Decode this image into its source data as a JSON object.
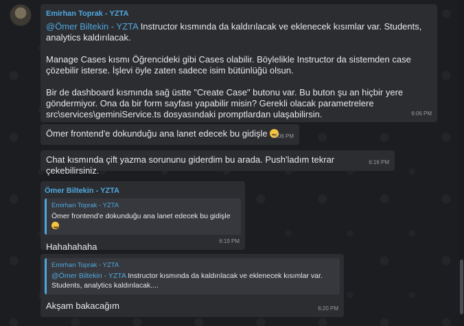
{
  "messages": [
    {
      "sender": "Emirhan Toprak - YZTA",
      "mention": "@Ömer Biltekin - YZTA",
      "p1_rest": " Instructor kısmında da kaldırılacak ve eklenecek kısımlar var. Students, analytics kaldırılacak.",
      "p2": "Manage Cases kısmı Öğrencideki gibi Cases olabilir. Böylelikle Instructor da sistemden case çözebilir isterse. İşlevi öyle zaten sadece isim bütünlüğü olsun.",
      "p3": "Bir de dashboard kısmında sağ üstte \"Create Case\"  butonu var. Bu buton şu an hiçbir yere göndermiyor. Ona da bir form sayfası yapabilir misin? Gerekli olacak parametrelere src\\services\\geminiService.ts dosyasındaki promptlardan ulaşabilirsin.",
      "time": "6:06 PM"
    },
    {
      "text": "Ömer frontend'e dokunduğu ana lanet edecek bu gidişle",
      "emoji": "joy-emoji",
      "time": "6:06 PM"
    },
    {
      "text": "Chat kısmında çift yazma sorununu giderdim bu arada. Push'ladım tekrar çekebilirsiniz.",
      "time": "6:16 PM"
    },
    {
      "sender": "Ömer Biltekin - YZTA",
      "reply_sender": "Emirhan Toprak - YZTA",
      "reply_text": "Ömer frontend'e dokunduğu ana lanet edecek bu gidişle",
      "text": "Hahahahaha",
      "time": "6:19 PM"
    },
    {
      "reply_sender": "Emirhan Toprak - YZTA",
      "reply_mention": "@Ömer Biltekin - YZTA",
      "reply_rest": " Instructor kısmında da kaldırılacak ve eklenecek kısımlar var. Students, analytics kaldırılacak....",
      "text": "Akşam bakacağım",
      "time": "6:20 PM"
    }
  ],
  "colors": {
    "accent": "#4ea8de",
    "bubble": "#2c2d31",
    "background": "#1c1d21"
  }
}
